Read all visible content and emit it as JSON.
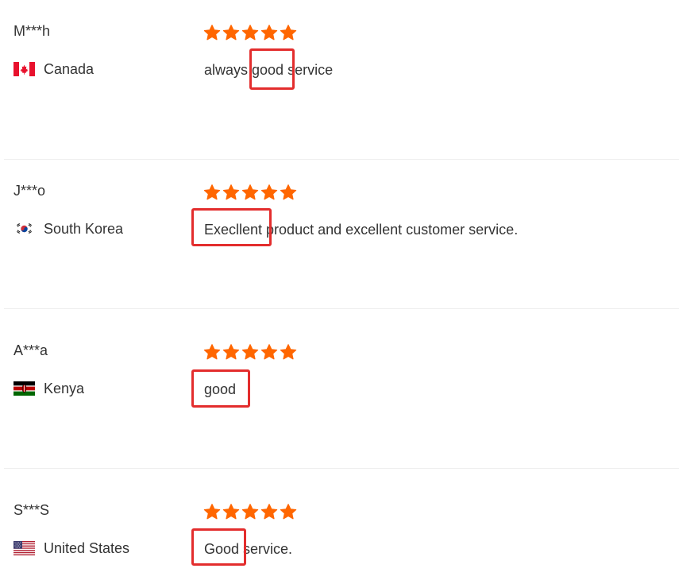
{
  "colors": {
    "star": "#ff6600",
    "highlight": "#e32d2d",
    "divider": "#eeeeee",
    "text": "#333333"
  },
  "reviews": [
    {
      "name": "M***h",
      "country": "Canada",
      "flag_icon": "canada-flag-icon",
      "rating": 5,
      "comment": "always good service",
      "highlighted_word": "good"
    },
    {
      "name": "J***o",
      "country": "South Korea",
      "flag_icon": "south-korea-flag-icon",
      "rating": 5,
      "comment": "Execllent product and excellent customer service.",
      "highlighted_word": "Execllent"
    },
    {
      "name": "A***a",
      "country": "Kenya",
      "flag_icon": "kenya-flag-icon",
      "rating": 5,
      "comment": "good",
      "highlighted_word": "good"
    },
    {
      "name": "S***S",
      "country": "United States",
      "flag_icon": "united-states-flag-icon",
      "rating": 5,
      "comment": "Good service.",
      "highlighted_word": "Good"
    }
  ]
}
